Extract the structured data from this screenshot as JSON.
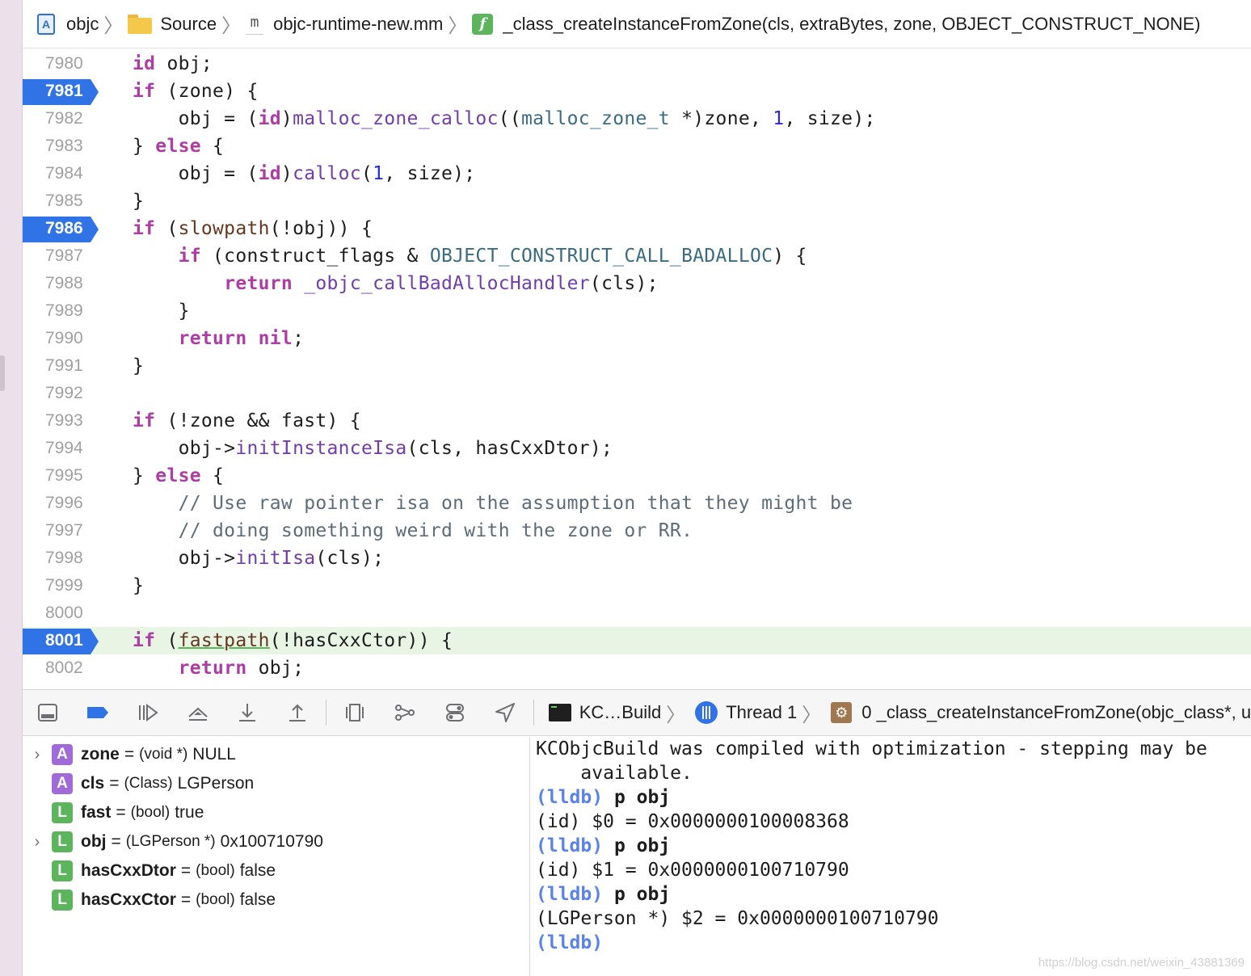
{
  "breadcrumb": {
    "project": "objc",
    "folder": "Source",
    "file_icon_glyph": "m",
    "file": "objc-runtime-new.mm",
    "function_icon_glyph": "f",
    "function": "_class_createInstanceFromZone(cls, extraBytes, zone, OBJECT_CONSTRUCT_NONE)"
  },
  "code": {
    "current_line": "8001",
    "breakpoints": [
      "7981",
      "7986",
      "8001"
    ],
    "lines": [
      {
        "n": "7980"
      },
      {
        "n": "7981"
      },
      {
        "n": "7982"
      },
      {
        "n": "7983"
      },
      {
        "n": "7984"
      },
      {
        "n": "7985"
      },
      {
        "n": "7986"
      },
      {
        "n": "7987"
      },
      {
        "n": "7988"
      },
      {
        "n": "7989"
      },
      {
        "n": "7990"
      },
      {
        "n": "7991"
      },
      {
        "n": "7992"
      },
      {
        "n": "7993"
      },
      {
        "n": "7994"
      },
      {
        "n": "7995"
      },
      {
        "n": "7996"
      },
      {
        "n": "7997"
      },
      {
        "n": "7998"
      },
      {
        "n": "7999"
      },
      {
        "n": "8000"
      },
      {
        "n": "8001"
      },
      {
        "n": "8002"
      }
    ],
    "text": {
      "l7980": "    id obj;",
      "l7981": "    if (zone) {",
      "l7982": "        obj = (id)malloc_zone_calloc((malloc_zone_t *)zone, 1, size);",
      "l7983": "    } else {",
      "l7984": "        obj = (id)calloc(1, size);",
      "l7985": "    }",
      "l7986": "    if (slowpath(!obj)) {",
      "l7987": "        if (construct_flags & OBJECT_CONSTRUCT_CALL_BADALLOC) {",
      "l7988": "            return _objc_callBadAllocHandler(cls);",
      "l7989": "        }",
      "l7990": "        return nil;",
      "l7991": "    }",
      "l7992": "",
      "l7993": "    if (!zone && fast) {",
      "l7994": "        obj->initInstanceIsa(cls, hasCxxDtor);",
      "l7995": "    } else {",
      "l7996": "        // Use raw pointer isa on the assumption that they might be",
      "l7997": "        // doing something weird with the zone or RR.",
      "l7998": "        obj->initIsa(cls);",
      "l7999": "    }",
      "l8000": "",
      "l8001": "    if (fastpath(!hasCxxCtor)) {",
      "l8002": "        return obj;"
    }
  },
  "debug_bar": {
    "buttons": [
      "hide-debug-area",
      "toggle-breakpoints",
      "continue",
      "step-over",
      "step-into",
      "step-out",
      "debug-view-hierarchy",
      "memory-graph",
      "environment-overrides",
      "simulate-location"
    ],
    "process": "KC…Build",
    "thread": "Thread 1",
    "frame": "0 _class_createInstanceFromZone(objc_class*, u"
  },
  "variables": [
    {
      "kind": "A",
      "expandable": true,
      "name": "zone",
      "type": "(void *)",
      "value": "NULL"
    },
    {
      "kind": "A",
      "expandable": false,
      "name": "cls",
      "type": "(Class)",
      "value": "LGPerson"
    },
    {
      "kind": "L",
      "expandable": false,
      "name": "fast",
      "type": "(bool)",
      "value": "true"
    },
    {
      "kind": "L",
      "expandable": true,
      "name": "obj",
      "type": "(LGPerson *)",
      "value": "0x100710790"
    },
    {
      "kind": "L",
      "expandable": false,
      "name": "hasCxxDtor",
      "type": "(bool)",
      "value": "false"
    },
    {
      "kind": "L",
      "expandable": false,
      "name": "hasCxxCtor",
      "type": "(bool)",
      "value": "false"
    }
  ],
  "console": {
    "warning_1": "KCObjcBuild was compiled with optimization - stepping may be",
    "warning_2": "    available.",
    "prompt": "(lldb)",
    "cmd_1": " p obj",
    "out_1": "(id) $0 = 0x0000000100008368",
    "cmd_2": " p obj",
    "out_2": "(id) $1 = 0x0000000100710790",
    "cmd_3": " p obj",
    "out_3": "(LGPerson *) $2 = 0x0000000100710790"
  },
  "watermark": "https://blog.csdn.net/weixin_43881369",
  "colors": {
    "keyword": "#ad3da4",
    "function": "#703daa",
    "type": "#3b6b82",
    "number": "#272ad8",
    "comment": "#5d6c79",
    "breakpoint": "#2f73e6",
    "current_line_bg": "#e8f5e5",
    "lldb_prompt": "#5b82e8"
  }
}
